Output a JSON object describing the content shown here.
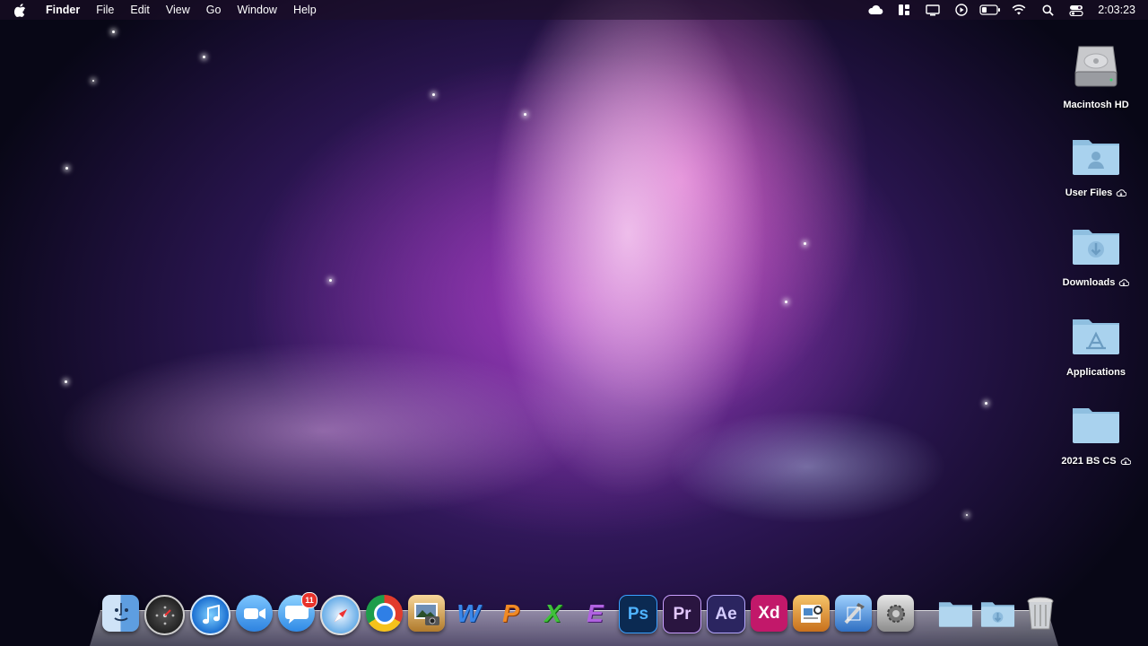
{
  "menubar": {
    "apple_icon": "apple-logo-icon",
    "app_name": "Finder",
    "menus": [
      "File",
      "Edit",
      "View",
      "Go",
      "Window",
      "Help"
    ],
    "status_icons": [
      "cloud-icon",
      "dashboard-icon",
      "display-icon",
      "play-icon",
      "battery-icon",
      "wifi-icon",
      "search-icon",
      "control-center-icon"
    ],
    "clock": "2:03:23"
  },
  "desktop": {
    "icons": [
      {
        "label": "Macintosh HD",
        "icon": "hard-drive-icon",
        "cloud": false
      },
      {
        "label": "User Files",
        "icon": "user-folder-icon",
        "cloud": true
      },
      {
        "label": "Downloads",
        "icon": "downloads-folder-icon",
        "cloud": true
      },
      {
        "label": "Applications",
        "icon": "applications-folder-icon",
        "cloud": false
      },
      {
        "label": "2021 BS CS",
        "icon": "folder-icon",
        "cloud": true
      }
    ]
  },
  "dock": {
    "items": [
      {
        "name": "finder-icon"
      },
      {
        "name": "dashboard-icon"
      },
      {
        "name": "itunes-icon"
      },
      {
        "name": "facetime-icon"
      },
      {
        "name": "messages-icon",
        "badge": "11"
      },
      {
        "name": "safari-icon"
      },
      {
        "name": "chrome-icon"
      },
      {
        "name": "iphoto-icon"
      },
      {
        "name": "word-icon",
        "text": "W"
      },
      {
        "name": "powerpoint-icon",
        "text": "P"
      },
      {
        "name": "excel-icon",
        "text": "X"
      },
      {
        "name": "onenote-icon",
        "text": "E"
      },
      {
        "name": "photoshop-icon",
        "text": "Ps"
      },
      {
        "name": "premiere-icon",
        "text": "Pr"
      },
      {
        "name": "after-effects-icon",
        "text": "Ae"
      },
      {
        "name": "xd-icon",
        "text": "Xd"
      },
      {
        "name": "preview-icon"
      },
      {
        "name": "xcode-icon"
      },
      {
        "name": "system-preferences-icon"
      },
      {
        "name": "folder-icon"
      },
      {
        "name": "downloads-stack-icon"
      },
      {
        "name": "trash-icon"
      }
    ]
  }
}
